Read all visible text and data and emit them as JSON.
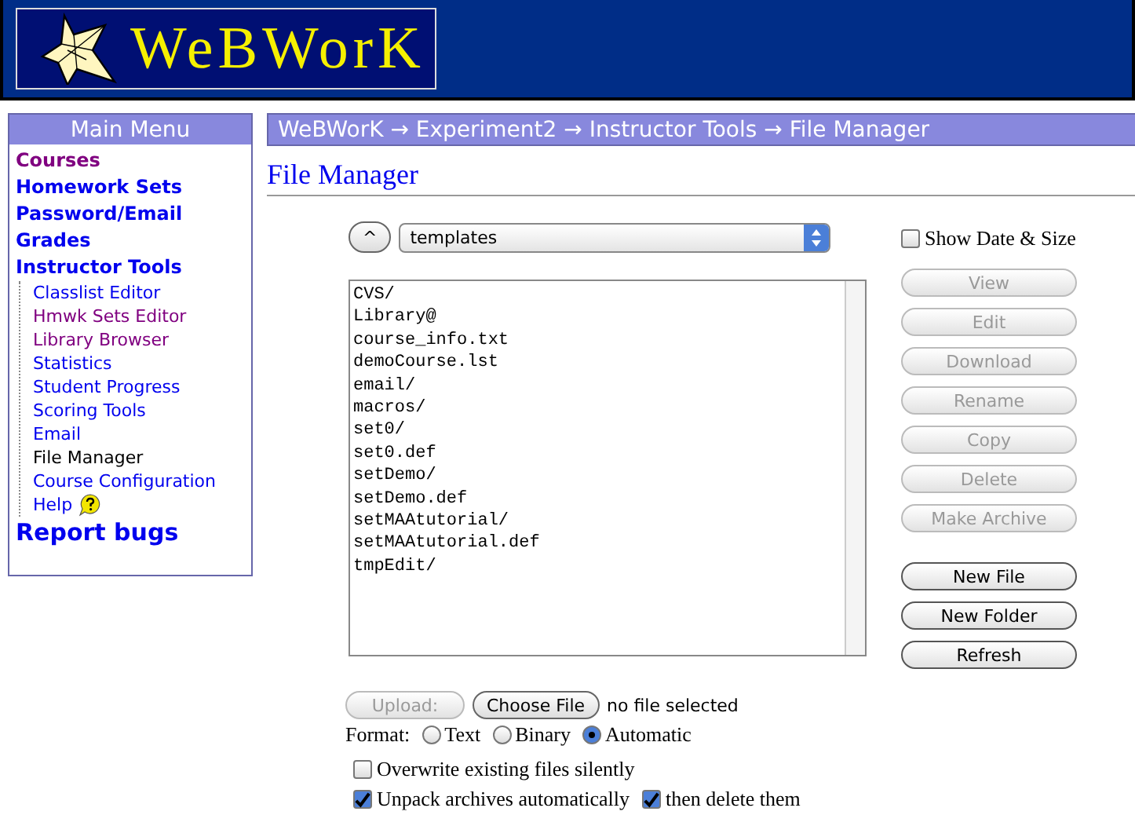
{
  "logo": {
    "text": "WeBWorK"
  },
  "menu": {
    "title": "Main Menu",
    "items": [
      {
        "label": "Courses",
        "kind": "visited"
      },
      {
        "label": "Homework Sets",
        "kind": "link"
      },
      {
        "label": "Password/Email",
        "kind": "link"
      },
      {
        "label": "Grades",
        "kind": "link"
      },
      {
        "label": "Instructor Tools",
        "kind": "link",
        "children": [
          {
            "label": "Classlist Editor",
            "kind": "link"
          },
          {
            "label": "Hmwk Sets Editor",
            "kind": "visited"
          },
          {
            "label": "Library Browser",
            "kind": "visited"
          },
          {
            "label": "Statistics",
            "kind": "link"
          },
          {
            "label": "Student Progress",
            "kind": "link"
          },
          {
            "label": "Scoring Tools",
            "kind": "link"
          },
          {
            "label": "Email",
            "kind": "link"
          },
          {
            "label": "File Manager",
            "kind": "current"
          },
          {
            "label": "Course Configuration",
            "kind": "link"
          },
          {
            "label": "Help",
            "kind": "help"
          }
        ]
      },
      {
        "label": "Report bugs",
        "kind": "big"
      }
    ]
  },
  "breadcrumb": "WeBWorK → Experiment2 → Instructor Tools → File Manager",
  "page_title": "File Manager",
  "up_button": "^",
  "directory": "templates",
  "files": [
    "CVS/",
    "Library@",
    "course_info.txt",
    "demoCourse.lst",
    "email/",
    "macros/",
    "set0/",
    "set0.def",
    "setDemo/",
    "setDemo.def",
    "setMAAtutorial/",
    "setMAAtutorial.def",
    "tmpEdit/"
  ],
  "show_date_size": {
    "label": "Show Date & Size",
    "checked": false
  },
  "file_actions": [
    {
      "label": "View",
      "disabled": true
    },
    {
      "label": "Edit",
      "disabled": true
    },
    {
      "label": "Download",
      "disabled": true
    },
    {
      "label": "Rename",
      "disabled": true
    },
    {
      "label": "Copy",
      "disabled": true
    },
    {
      "label": "Delete",
      "disabled": true
    },
    {
      "label": "Make Archive",
      "disabled": true
    }
  ],
  "folder_actions": [
    {
      "label": "New File",
      "disabled": false
    },
    {
      "label": "New Folder",
      "disabled": false
    },
    {
      "label": "Refresh",
      "disabled": false
    }
  ],
  "upload": {
    "label": "Upload:",
    "disabled": true,
    "choose": "Choose File",
    "status": "no file selected"
  },
  "format": {
    "label": "Format:",
    "options": [
      {
        "label": "Text",
        "selected": false
      },
      {
        "label": "Binary",
        "selected": false
      },
      {
        "label": "Automatic",
        "selected": true
      }
    ]
  },
  "options": [
    {
      "label": "Overwrite existing files silently",
      "checked": false
    },
    {
      "label": "Unpack archives automatically",
      "checked": true
    },
    {
      "label": "then delete them",
      "checked": true
    }
  ]
}
